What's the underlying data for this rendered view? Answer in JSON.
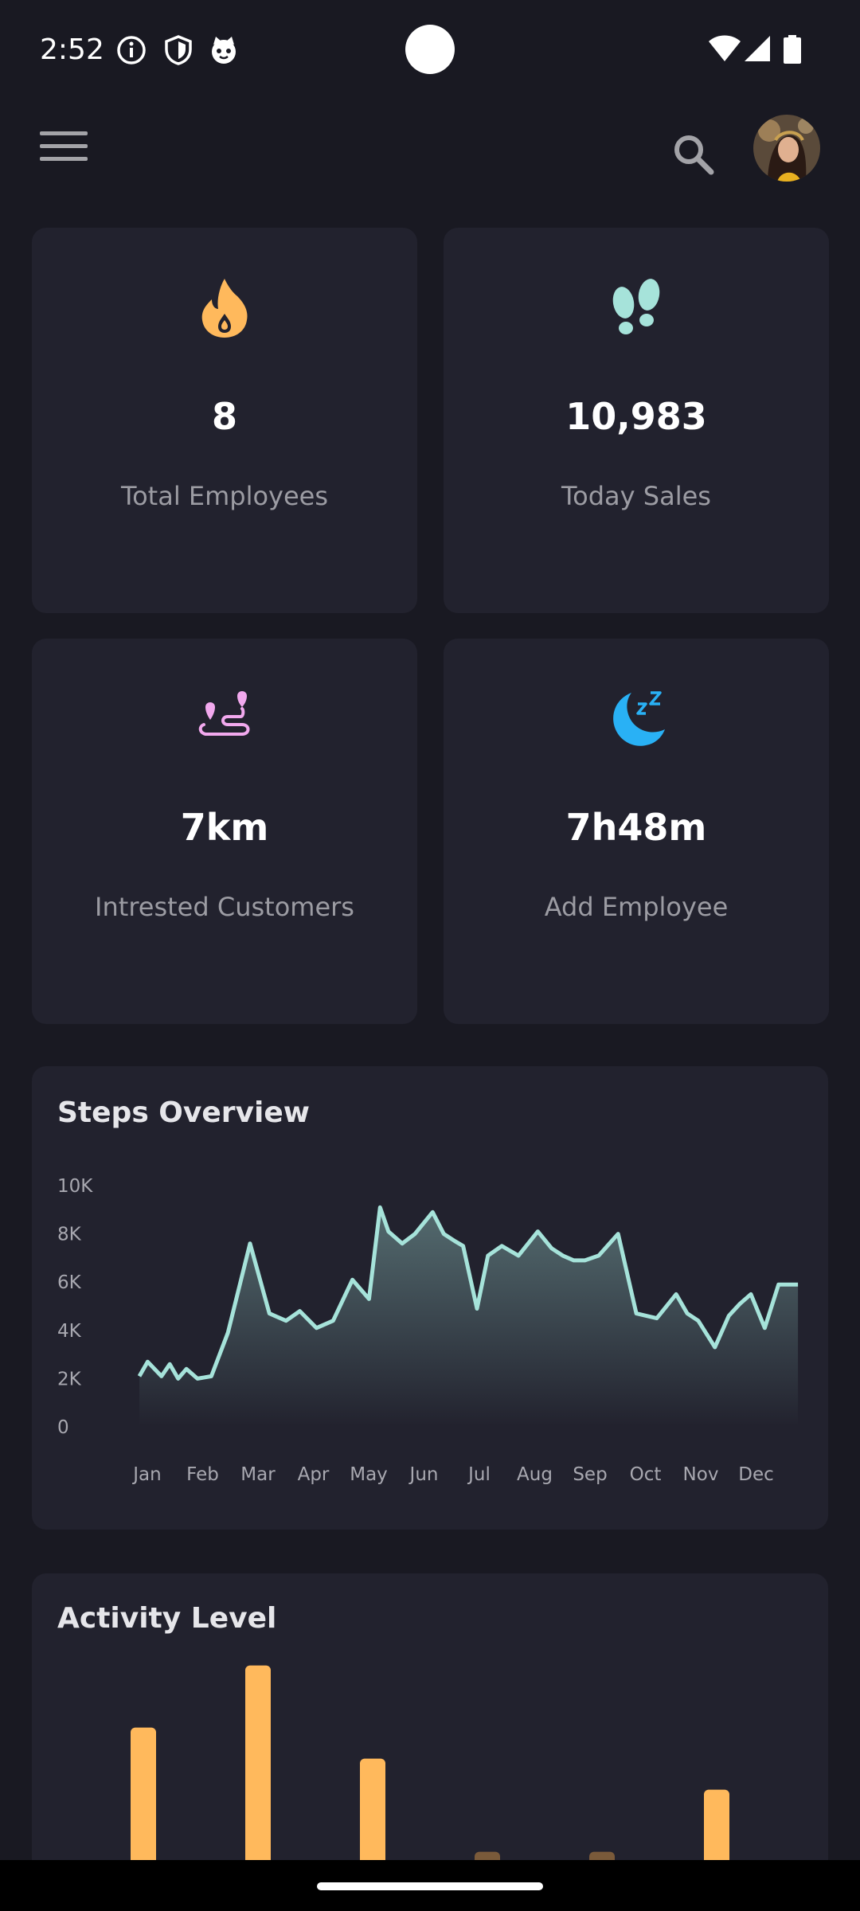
{
  "status_bar": {
    "time": "2:52",
    "icons": [
      "info-icon",
      "shield-icon",
      "cat-icon",
      "wifi-icon",
      "signal-icon",
      "battery-icon"
    ]
  },
  "app_bar": {
    "menu_icon": "menu-icon",
    "search_icon": "search-icon",
    "avatar": "user-avatar"
  },
  "stats": [
    {
      "icon": "flame-icon",
      "value": "8",
      "label": "Total Employees",
      "color": "#FFB95C"
    },
    {
      "icon": "footsteps-icon",
      "value": "10,983",
      "label": "Today Sales",
      "color": "#A6E3DA"
    },
    {
      "icon": "route-icon",
      "value": "7km",
      "label": "Intrested Customers",
      "color": "#F2A9EE"
    },
    {
      "icon": "sleep-moon-icon",
      "value": "7h48m",
      "label": "Add Employee",
      "color": "#29B1F5"
    }
  ],
  "steps_card": {
    "title": "Steps Overview"
  },
  "activity_card": {
    "title": "Activity Level"
  },
  "colors": {
    "background": "#191922",
    "card": "#22222E",
    "line": "#A6E3DA",
    "bar": "#FFB95C",
    "bar_dim": "#7A5A3A"
  },
  "chart_data": [
    {
      "type": "area",
      "title": "Steps Overview",
      "categories": [
        "Jan",
        "Feb",
        "Mar",
        "Apr",
        "May",
        "Jun",
        "Jul",
        "Aug",
        "Sep",
        "Oct",
        "Nov",
        "Dec"
      ],
      "y_ticks": [
        "0",
        "2K",
        "4K",
        "6K",
        "8K",
        "10K"
      ],
      "ylim": [
        0,
        10000
      ],
      "grid": false,
      "series": [
        {
          "x": [
            0,
            0.15,
            0.4,
            0.55,
            0.7,
            0.85,
            1.05,
            1.3,
            1.6,
            2.0,
            2.35,
            2.65,
            2.9,
            3.2,
            3.5,
            3.85,
            4.15,
            4.35,
            4.5,
            4.75,
            4.98,
            5.3,
            5.5,
            5.7,
            5.85,
            6.1,
            6.3,
            6.55,
            6.85,
            7.2,
            7.45,
            7.65,
            7.85,
            8.05,
            8.3,
            8.65,
            8.98,
            9.35,
            9.7,
            9.9,
            10.1,
            10.4,
            10.65,
            10.85,
            11.05,
            11.3,
            11.55,
            11.75,
            11.9
          ],
          "y": [
            2100,
            2700,
            2100,
            2600,
            2000,
            2400,
            2000,
            2100,
            3900,
            7600,
            4700,
            4400,
            4800,
            4100,
            4400,
            6100,
            5300,
            9100,
            8100,
            7600,
            8000,
            8900,
            8000,
            7700,
            7500,
            4900,
            7100,
            7500,
            7100,
            8100,
            7400,
            7100,
            6900,
            6900,
            7100,
            8000,
            4700,
            4500,
            5500,
            4700,
            4400,
            3300,
            4600,
            5100,
            5500,
            4100,
            5900,
            5900,
            5900
          ],
          "color": "#A6E3DA"
        }
      ]
    },
    {
      "type": "bar",
      "title": "Activity Level",
      "values": [
        0.64,
        0.94,
        0.49,
        0.04,
        0.04,
        0.34
      ],
      "value_unit": "fraction of visible bar height",
      "colors": [
        "#FFB95C",
        "#FFB95C",
        "#FFB95C",
        "#7A5A3A",
        "#7A5A3A",
        "#FFB95C"
      ]
    }
  ]
}
